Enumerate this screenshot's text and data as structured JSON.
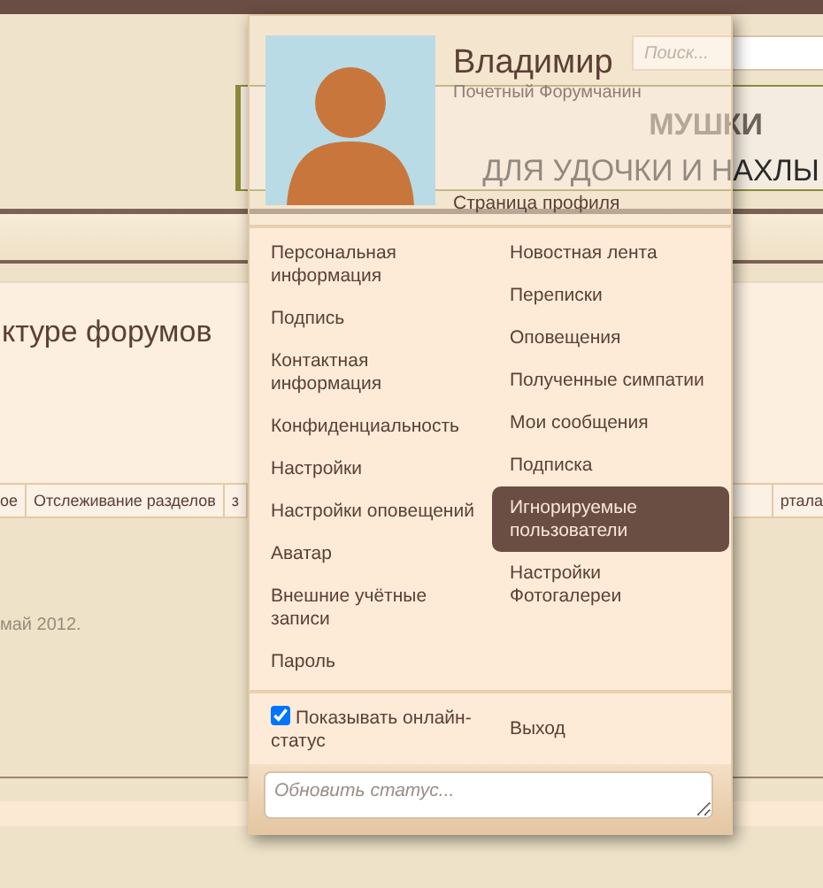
{
  "page": {
    "search": {
      "placeholder": "Поиск..."
    },
    "banner": {
      "title": "МУШКИ",
      "tagline": "ДЛЯ УДОЧКИ И НАХЛЫ"
    },
    "heading": "ктуре форумов",
    "tabs": [
      "ое",
      "Отслеживание разделов",
      "з"
    ],
    "tab_right": "ртала",
    "date_text": "май 2012."
  },
  "user_menu": {
    "name": "Владимир",
    "title": "Почетный Форумчанин",
    "profile_link": "Страница профиля",
    "left_links": [
      {
        "label": "Персональная информация"
      },
      {
        "label": "Подпись"
      },
      {
        "label": "Контактная информация"
      },
      {
        "label": "Конфиденциальность"
      },
      {
        "label": "Настройки"
      },
      {
        "label": "Настройки оповещений"
      },
      {
        "label": "Аватар"
      },
      {
        "label": "Внешние учётные записи"
      },
      {
        "label": "Пароль"
      }
    ],
    "right_links": [
      {
        "label": "Новостная лента",
        "selected": false
      },
      {
        "label": "Переписки",
        "selected": false
      },
      {
        "label": "Оповещения",
        "selected": false
      },
      {
        "label": "Полученные симпатии",
        "selected": false
      },
      {
        "label": "Мои сообщения",
        "selected": false
      },
      {
        "label": "Подписка",
        "selected": false
      },
      {
        "label": "Игнорируемые пользователи",
        "selected": true
      },
      {
        "label": "Настройки Фотогалереи",
        "selected": false
      }
    ],
    "online_status": {
      "label": "Показывать онлайн-статус",
      "checked": true
    },
    "logout": "Выход",
    "status_field": {
      "placeholder": "Обновить статус..."
    }
  }
}
